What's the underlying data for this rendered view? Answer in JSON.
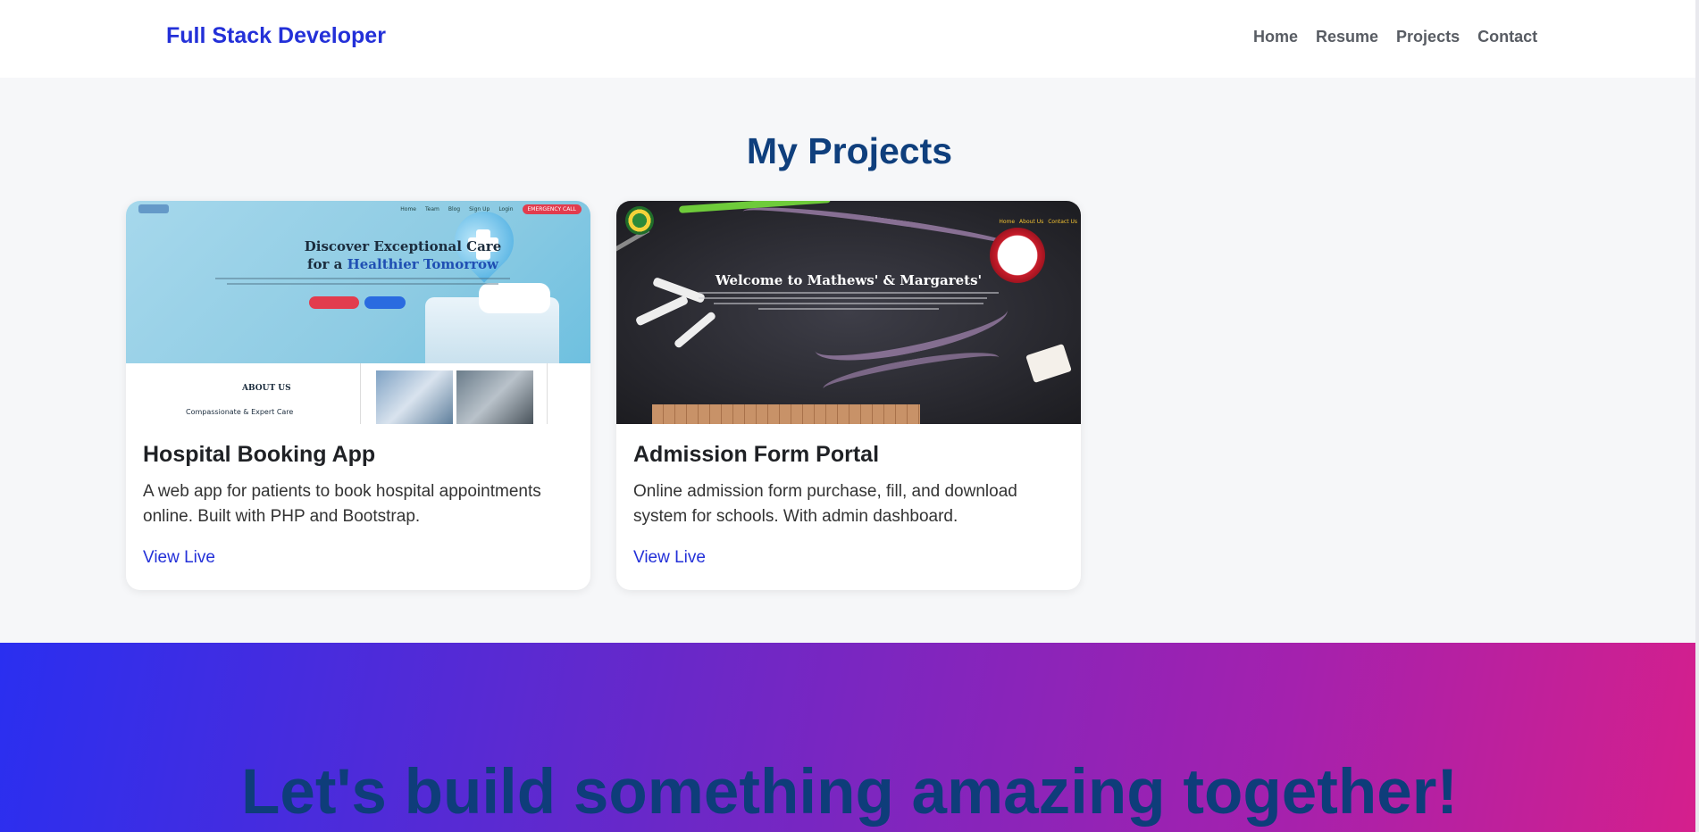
{
  "navbar": {
    "brand": "Full Stack Developer",
    "links": [
      "Home",
      "Resume",
      "Projects",
      "Contact"
    ]
  },
  "projects": {
    "title": "My Projects",
    "items": [
      {
        "title": "Hospital Booking App",
        "description": "A web app for patients to book hospital appointments online. Built with PHP and Bootstrap.",
        "link_label": "View Live",
        "thumbnail": {
          "headline_1": "Discover Exceptional Care",
          "headline_2_prefix": "for a ",
          "headline_2_highlight": "Healthier Tomorrow",
          "nav": [
            "Home",
            "Team",
            "Blog",
            "Sign Up",
            "Login"
          ],
          "emergency": "EMERGENCY CALL",
          "about": "ABOUT US",
          "care": "Compassionate & Expert Care"
        }
      },
      {
        "title": "Admission Form Portal",
        "description": "Online admission form purchase, fill, and download system for schools. With admin dashboard.",
        "link_label": "View Live",
        "thumbnail": {
          "headline": "Welcome to Mathews' & Margarets'",
          "nav": [
            "Home",
            "About Us",
            "Contact Us"
          ]
        }
      }
    ]
  },
  "cta": {
    "headline": "Let's build something amazing together!"
  },
  "colors": {
    "brand": "#2330d8",
    "title": "#0f3f7d",
    "cta_gradient_start": "#2a2ff0",
    "cta_gradient_end": "#d51f8c"
  }
}
